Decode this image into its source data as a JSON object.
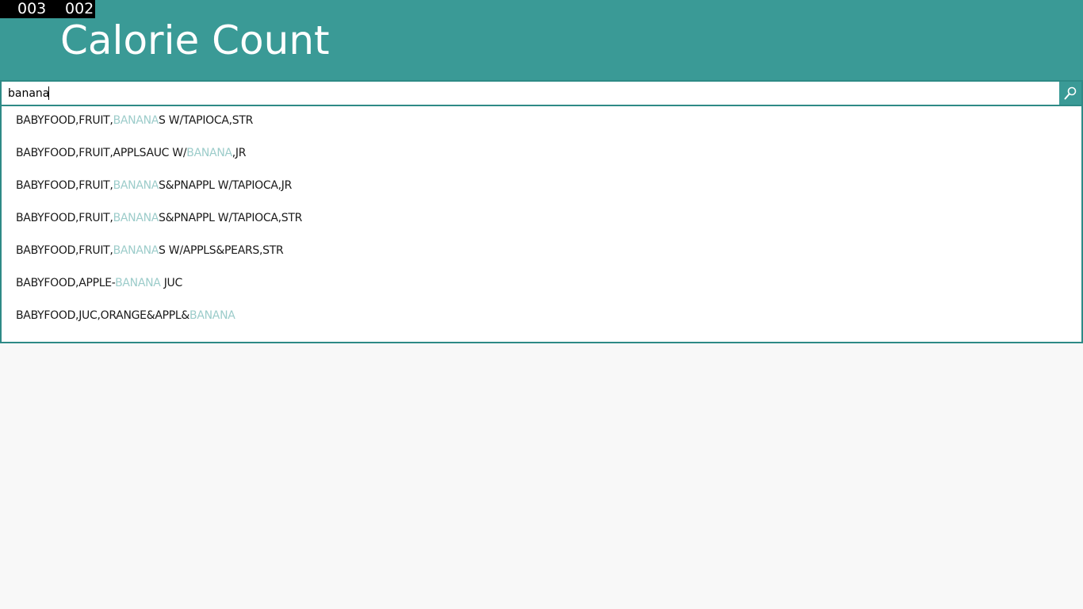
{
  "counters": {
    "left": "003",
    "right": "002"
  },
  "app": {
    "title": "Calorie Count"
  },
  "search": {
    "value": "banana",
    "button_icon": "search-icon"
  },
  "suggestions": [
    {
      "before": "BABYFOOD,FRUIT,",
      "match": "BANANA",
      "after": "S W/TAPIOCA,STR"
    },
    {
      "before": "BABYFOOD,FRUIT,APPLSAUC W/",
      "match": "BANANA",
      "after": ",JR"
    },
    {
      "before": "BABYFOOD,FRUIT,",
      "match": "BANANA",
      "after": "S&PNAPPL W/TAPIOCA,JR"
    },
    {
      "before": "BABYFOOD,FRUIT,",
      "match": "BANANA",
      "after": "S&PNAPPL W/TAPIOCA,STR"
    },
    {
      "before": "BABYFOOD,FRUIT,",
      "match": "BANANA",
      "after": "S W/APPLS&PEARS,STR"
    },
    {
      "before": "BABYFOOD,APPLE-",
      "match": "BANANA",
      "after": " JUC"
    },
    {
      "before": "BABYFOOD,JUC,ORANGE&APPL&",
      "match": "BANANA",
      "after": ""
    }
  ],
  "colors": {
    "header": "#3a9a96",
    "border": "#2e8a86",
    "highlight": "#9cccca",
    "background": "#f8f8f8"
  }
}
